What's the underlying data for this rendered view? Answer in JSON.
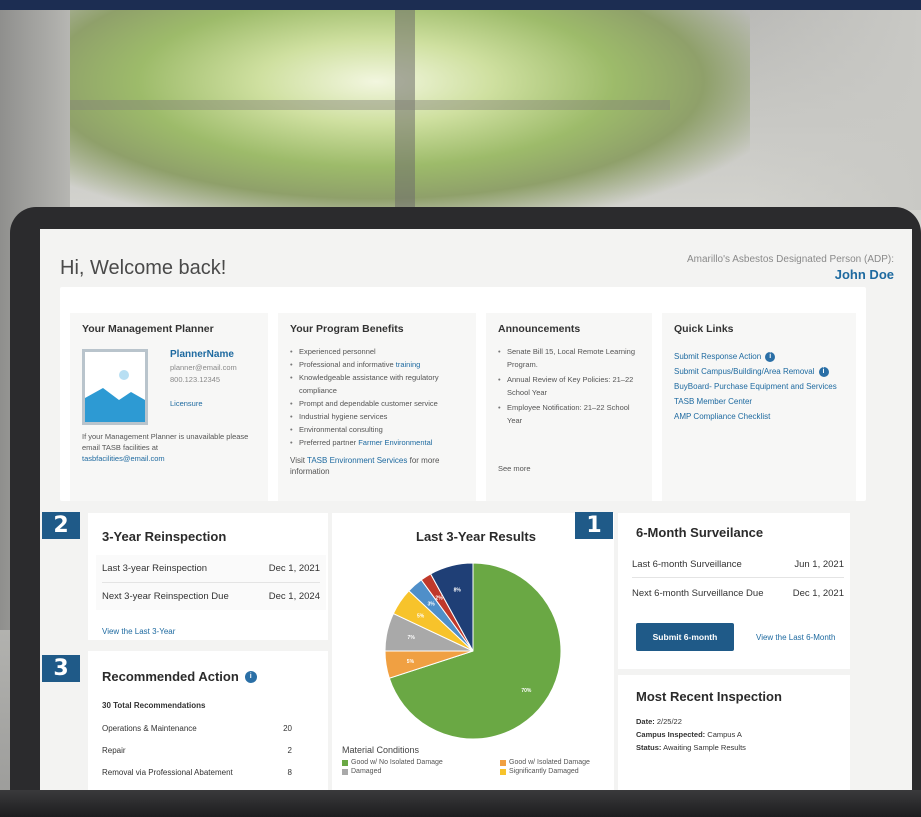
{
  "colors": {
    "brand": "#1f5a88",
    "link": "#1e6aa0",
    "good": "#6aa844",
    "isolated": "#f0a042",
    "damaged": "#a9a9a9",
    "significant": "#f7c32b",
    "blue": "#4f8fc9",
    "navy": "#1f3f76",
    "red": "#c0392b"
  },
  "header": {
    "welcome": "Hi, Welcome back!",
    "adp_label": "Amarillo's Asbestos Designated Person (ADP):",
    "adp_name": "John Doe"
  },
  "planner": {
    "title": "Your Management Planner",
    "name": "PlannerName",
    "email": "planner@email.com",
    "phone": "800.123.12345",
    "licensure": "Licensure",
    "note": "If your Management Planner is unavailable please email TASB facilities at",
    "note_email": "tasbfacilities@email.com"
  },
  "benefits": {
    "title": "Your Program Benefits",
    "items": [
      {
        "text": "Experienced personnel",
        "link": ""
      },
      {
        "text": "Professional and informative",
        "link": "training"
      },
      {
        "text": "Knowledgeable assistance with regulatory compliance",
        "link": ""
      },
      {
        "text": "Prompt and dependable customer service",
        "link": ""
      },
      {
        "text": "Industrial hygiene services",
        "link": ""
      },
      {
        "text": "Environmental consulting",
        "link": ""
      },
      {
        "text": "Preferred partner",
        "link": "Farmer Environmental"
      }
    ],
    "visit_prefix": "Visit",
    "visit_link": "TASB Environment Services",
    "visit_suffix": "for more information"
  },
  "announcements": {
    "title": "Announcements",
    "items": [
      "Senate Bill 15, Local Remote Learning Program.",
      "Annual Review of Key Policies: 21–22 School Year",
      "Employee Notification: 21–22 School Year"
    ],
    "see_more": "See more"
  },
  "quick_links": {
    "title": "Quick Links",
    "items": [
      {
        "label": "Submit Response Action",
        "info": true
      },
      {
        "label": "Submit Campus/Building/Area Removal",
        "info": true
      },
      {
        "label": "BuyBoard- Purchase Equipment and Services",
        "info": false
      },
      {
        "label": "TASB Member Center",
        "info": false
      },
      {
        "label": "AMP Compliance Checklist",
        "info": false
      }
    ]
  },
  "reinspection": {
    "badge": "2",
    "title": "3-Year Reinspection",
    "rows": [
      {
        "label": "Last 3-year Reinspection",
        "value": "Dec 1, 2021"
      },
      {
        "label": "Next 3-year Reinspection Due",
        "value": "Dec 1, 2024"
      }
    ],
    "view_link": "View the Last 3-Year"
  },
  "recommended": {
    "badge": "3",
    "title": "Recommended Action",
    "total": "30 Total Recommendations",
    "rows": [
      {
        "label": "Operations & Maintenance",
        "value": "20"
      },
      {
        "label": "Repair",
        "value": "2"
      },
      {
        "label": "Removal via Professional Abatement",
        "value": "8"
      }
    ]
  },
  "chart_data": {
    "type": "pie",
    "title": "Last 3-Year Results",
    "legend_title": "Material Conditions",
    "legend_placement": "bottom",
    "slices": [
      {
        "label": "Good w/ No Isolated Damage",
        "value": 70,
        "text": "70%",
        "color": "#6aa844"
      },
      {
        "label": "Good w/ Isolated Damage",
        "value": 5,
        "text": "5%",
        "color": "#f0a042"
      },
      {
        "label": "Damaged",
        "value": 7,
        "text": "7%",
        "color": "#a9a9a9"
      },
      {
        "label": "Significantly Damaged",
        "value": 5,
        "text": "5%",
        "color": "#f7c32b"
      },
      {
        "label": "",
        "value": 3,
        "text": "3%",
        "color": "#4f8fc9"
      },
      {
        "label": "",
        "value": 2,
        "text": "2%",
        "color": "#c0392b"
      },
      {
        "label": "",
        "value": 8,
        "text": "8%",
        "color": "#1f3f76"
      }
    ]
  },
  "surveillance": {
    "badge": "1",
    "title": "6-Month Surveilance",
    "rows": [
      {
        "label": "Last 6-month Surveillance",
        "value": "Jun 1, 2021"
      },
      {
        "label": "Next 6-month Surveillance Due",
        "value": "Dec 1, 2021"
      }
    ],
    "submit_label": "Submit 6-month",
    "view_link": "View the Last 6-Month"
  },
  "inspection": {
    "title": "Most Recent Inspection",
    "date_label": "Date:",
    "date_value": "2/25/22",
    "campus_label": "Campus Inspected:",
    "campus_value": "Campus A",
    "status_label": "Status:",
    "status_value": "Awaiting Sample Results"
  }
}
